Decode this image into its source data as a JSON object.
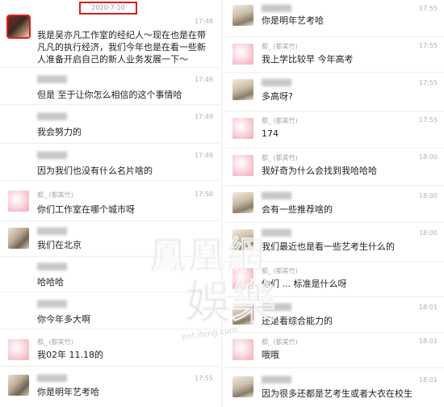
{
  "header": {
    "date_badge": "2020-7-10"
  },
  "left": [
    {
      "avatar": "dark",
      "sel": true,
      "name": "",
      "blur": true,
      "time": "17:48",
      "text": "我是吴亦凡工作室的经纪人～现在也是在带凡凡的执行经济，我们今年也是在看一些新人准备开启自己的新人业务发展一下～"
    },
    {
      "avatar": "none",
      "name": "",
      "blur": true,
      "time": "17:49",
      "text": "但是 至于让你怎么相信的这个事情哈"
    },
    {
      "avatar": "none",
      "name": "",
      "blur": true,
      "time": "17:49",
      "text": "我会努力的"
    },
    {
      "avatar": "none",
      "name": "",
      "blur": true,
      "time": "17:49",
      "text": "因为我们也没有什么名片啥的"
    },
    {
      "avatar": "pink",
      "name": "都_ (都美竹)",
      "blur": false,
      "time": "17:50",
      "text": "你们工作室在哪个城市呀"
    },
    {
      "avatar": "photo",
      "name": "",
      "blur": true,
      "time": "",
      "text": "我们在北京"
    },
    {
      "avatar": "none",
      "name": "",
      "blur": true,
      "time": "",
      "text": "哈哈哈"
    },
    {
      "avatar": "none",
      "name": "",
      "blur": true,
      "time": "",
      "text": "你今年多大啊"
    },
    {
      "avatar": "pink",
      "name": "都_ (都美竹)",
      "blur": false,
      "time": "",
      "text": "我02年 11.18的"
    },
    {
      "avatar": "photo",
      "name": "",
      "blur": true,
      "time": "17:55",
      "text": "你是明年艺考哈"
    }
  ],
  "right": [
    {
      "avatar": "photo2",
      "name": "",
      "blur": true,
      "time": "17:55",
      "text": "你是明年艺考哈"
    },
    {
      "avatar": "pink",
      "name": "都_ (都美竹)",
      "blur": false,
      "time": "17:55",
      "text": "我上学比较早 今年高考"
    },
    {
      "avatar": "photo2",
      "name": "",
      "blur": true,
      "time": "17:55",
      "text": "多高呀?"
    },
    {
      "avatar": "pink",
      "name": "都_ (都美竹)",
      "blur": false,
      "time": "17:55",
      "text": "174"
    },
    {
      "avatar": "pink",
      "name": "都_ (都美竹)",
      "blur": false,
      "time": "18:00",
      "text": "我好奇为什么会找到我哈哈哈"
    },
    {
      "avatar": "photo2",
      "name": "",
      "blur": true,
      "time": "18:00",
      "text": "会有一些推荐啥的"
    },
    {
      "avatar": "photo2",
      "name": "",
      "blur": true,
      "time": "18:00",
      "text": "我们最近也是看一些艺考生什么的"
    },
    {
      "avatar": "pink",
      "name": "都_ (都美竹)",
      "blur": false,
      "time": "",
      "text": "你们 ... 标准是什么呀"
    },
    {
      "avatar": "photo2",
      "name": "",
      "blur": true,
      "time": "18:01",
      "text": "还是看综合能力的"
    },
    {
      "avatar": "pink",
      "name": "都_ (都美竹)",
      "blur": false,
      "time": "18:01",
      "text": "哦哦"
    },
    {
      "avatar": "photo2",
      "name": "",
      "blur": true,
      "time": "18:01",
      "text": "因为很多还都是艺考生或者大衣在校生"
    }
  ],
  "watermark": {
    "line1": "鳳凰網",
    "line2": "娛樂",
    "url": "ent.ifeng.com"
  }
}
